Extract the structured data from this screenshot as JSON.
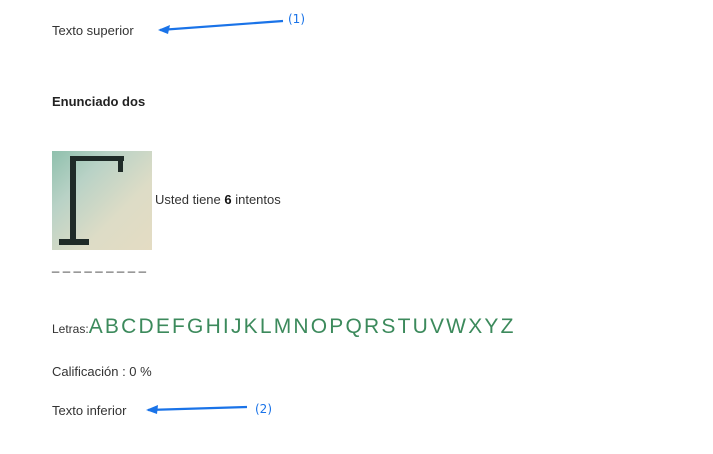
{
  "text_top": "Texto superior",
  "annotations": {
    "one": "(1)",
    "two": "(2)"
  },
  "statement": "Enunciado dos",
  "hangman": {
    "image_icon": "hangman-gallows-icon",
    "attempts_prefix": "Usted tiene ",
    "attempts_count": "6",
    "attempts_suffix": " intentos"
  },
  "word_blanks": "_ _ _ _ _ _ _ _ _",
  "letters": {
    "label": "Letras:",
    "items": [
      "A",
      "B",
      "C",
      "D",
      "E",
      "F",
      "G",
      "H",
      "I",
      "J",
      "K",
      "L",
      "M",
      "N",
      "O",
      "P",
      "Q",
      "R",
      "S",
      "T",
      "U",
      "V",
      "W",
      "X",
      "Y",
      "Z"
    ]
  },
  "score": "Calificación : 0 %",
  "text_bottom": "Texto inferior",
  "colors": {
    "letters": "#3c8a5c",
    "annotation": "#1a73e8"
  }
}
